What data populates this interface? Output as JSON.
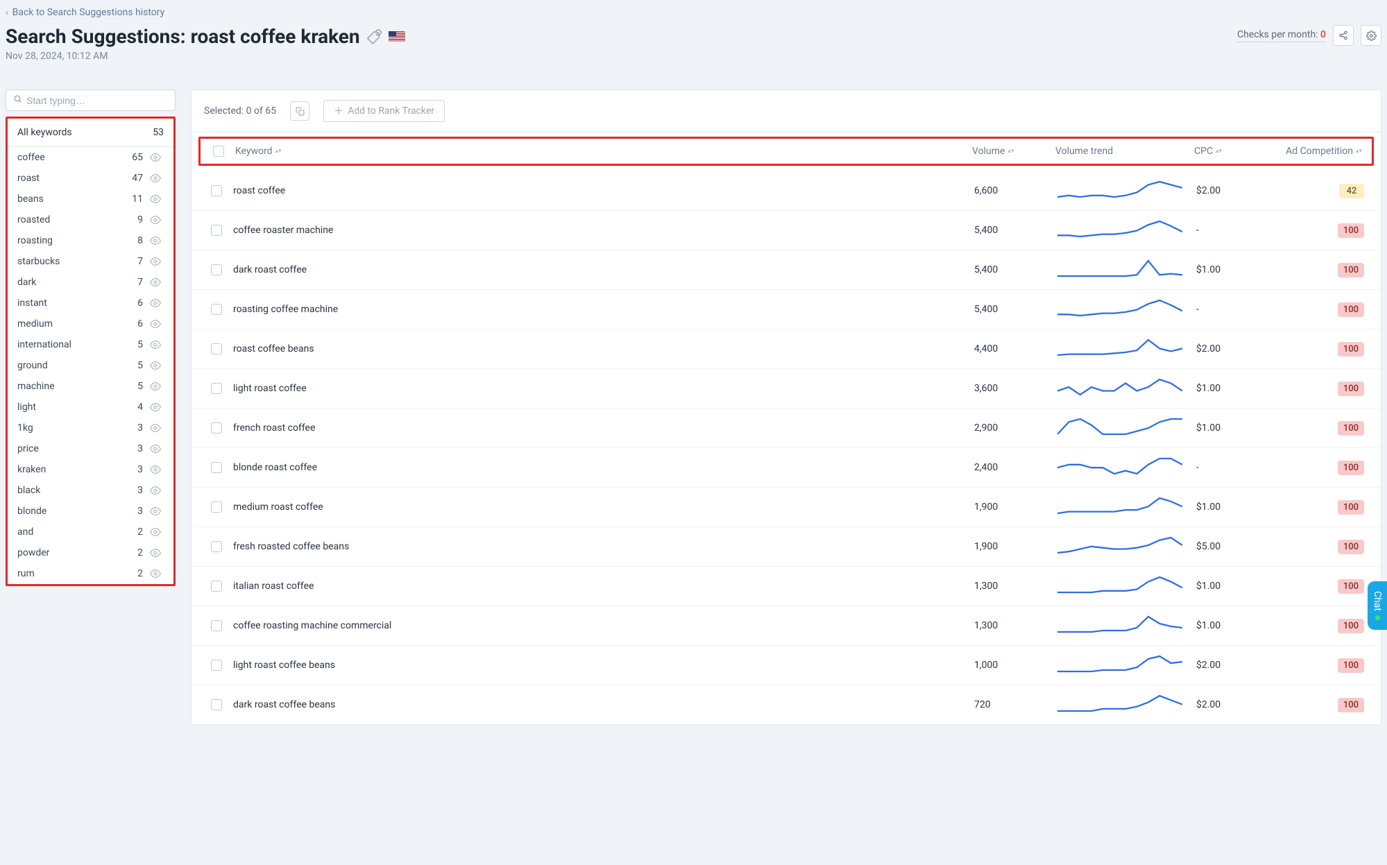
{
  "back_link": "Back to Search Suggestions history",
  "page_title_prefix": "Search Suggestions: ",
  "page_title_query": "roast coffee kraken",
  "timestamp": "Nov 28, 2024, 10:12 AM",
  "checks_label": "Checks per month: ",
  "checks_value": "0",
  "search_placeholder": "Start typing…",
  "sidebar": {
    "all_label": "All keywords",
    "all_count": "53",
    "items": [
      {
        "name": "coffee",
        "count": "65"
      },
      {
        "name": "roast",
        "count": "47"
      },
      {
        "name": "beans",
        "count": "11"
      },
      {
        "name": "roasted",
        "count": "9"
      },
      {
        "name": "roasting",
        "count": "8"
      },
      {
        "name": "starbucks",
        "count": "7"
      },
      {
        "name": "dark",
        "count": "7"
      },
      {
        "name": "instant",
        "count": "6"
      },
      {
        "name": "medium",
        "count": "6"
      },
      {
        "name": "international",
        "count": "5"
      },
      {
        "name": "ground",
        "count": "5"
      },
      {
        "name": "machine",
        "count": "5"
      },
      {
        "name": "light",
        "count": "4"
      },
      {
        "name": "1kg",
        "count": "3"
      },
      {
        "name": "price",
        "count": "3"
      },
      {
        "name": "kraken",
        "count": "3"
      },
      {
        "name": "black",
        "count": "3"
      },
      {
        "name": "blonde",
        "count": "3"
      },
      {
        "name": "and",
        "count": "2"
      },
      {
        "name": "powder",
        "count": "2"
      },
      {
        "name": "rum",
        "count": "2"
      }
    ]
  },
  "toolbar": {
    "selected_label": "Selected: 0 of 65",
    "add_label": "Add to Rank Tracker"
  },
  "columns": {
    "keyword": "Keyword",
    "volume": "Volume",
    "trend": "Volume trend",
    "cpc": "CPC",
    "comp": "Ad Competition"
  },
  "rows": [
    {
      "keyword": "roast coffee",
      "volume": "6,600",
      "cpc": "$2.00",
      "comp": "42",
      "comp_level": "yellow",
      "trend": [
        12,
        13,
        12,
        13,
        13,
        12,
        13,
        15,
        20,
        22,
        20,
        18
      ]
    },
    {
      "keyword": "coffee roaster machine",
      "volume": "5,400",
      "cpc": "-",
      "comp": "100",
      "comp_level": "red",
      "trend": [
        12,
        12,
        11,
        12,
        13,
        13,
        14,
        16,
        21,
        24,
        20,
        15
      ]
    },
    {
      "keyword": "dark roast coffee",
      "volume": "5,400",
      "cpc": "$1.00",
      "comp": "100",
      "comp_level": "red",
      "trend": [
        12,
        12,
        12,
        12,
        12,
        12,
        12,
        13,
        25,
        13,
        14,
        13
      ]
    },
    {
      "keyword": "roasting coffee machine",
      "volume": "5,400",
      "cpc": "-",
      "comp": "100",
      "comp_level": "red",
      "trend": [
        12,
        12,
        11,
        12,
        13,
        13,
        14,
        16,
        21,
        24,
        20,
        15
      ]
    },
    {
      "keyword": "roast coffee beans",
      "volume": "4,400",
      "cpc": "$2.00",
      "comp": "100",
      "comp_level": "red",
      "trend": [
        10,
        11,
        11,
        11,
        11,
        12,
        13,
        15,
        26,
        17,
        14,
        17
      ]
    },
    {
      "keyword": "light roast coffee",
      "volume": "3,600",
      "cpc": "$1.00",
      "comp": "100",
      "comp_level": "red",
      "trend": [
        13,
        14,
        12,
        14,
        13,
        13,
        15,
        13,
        14,
        16,
        15,
        13
      ]
    },
    {
      "keyword": "french roast coffee",
      "volume": "2,900",
      "cpc": "$1.00",
      "comp": "100",
      "comp_level": "red",
      "trend": [
        12,
        16,
        17,
        15,
        12,
        12,
        12,
        13,
        14,
        16,
        17,
        17
      ]
    },
    {
      "keyword": "blonde roast coffee",
      "volume": "2,400",
      "cpc": "-",
      "comp": "100",
      "comp_level": "red",
      "trend": [
        14,
        15,
        15,
        14,
        14,
        12,
        13,
        12,
        15,
        17,
        17,
        15
      ]
    },
    {
      "keyword": "medium roast coffee",
      "volume": "1,900",
      "cpc": "$1.00",
      "comp": "100",
      "comp_level": "red",
      "trend": [
        11,
        12,
        12,
        12,
        12,
        12,
        13,
        13,
        15,
        20,
        18,
        15
      ]
    },
    {
      "keyword": "fresh roasted coffee beans",
      "volume": "1,900",
      "cpc": "$5.00",
      "comp": "100",
      "comp_level": "red",
      "trend": [
        10,
        11,
        13,
        15,
        14,
        13,
        13,
        14,
        16,
        20,
        22,
        16
      ]
    },
    {
      "keyword": "italian roast coffee",
      "volume": "1,300",
      "cpc": "$1.00",
      "comp": "100",
      "comp_level": "red",
      "trend": [
        11,
        11,
        11,
        11,
        12,
        12,
        12,
        13,
        18,
        21,
        18,
        14
      ]
    },
    {
      "keyword": "coffee roasting machine commercial",
      "volume": "1,300",
      "cpc": "$1.00",
      "comp": "100",
      "comp_level": "red",
      "trend": [
        11,
        11,
        11,
        11,
        12,
        12,
        12,
        14,
        22,
        17,
        15,
        14
      ]
    },
    {
      "keyword": "light roast coffee beans",
      "volume": "1,000",
      "cpc": "$2.00",
      "comp": "100",
      "comp_level": "red",
      "trend": [
        11,
        11,
        11,
        11,
        12,
        12,
        12,
        14,
        20,
        22,
        17,
        18
      ]
    },
    {
      "keyword": "dark roast coffee beans",
      "volume": "720",
      "cpc": "$2.00",
      "comp": "100",
      "comp_level": "red",
      "trend": [
        11,
        11,
        11,
        11,
        12,
        12,
        12,
        13,
        15,
        18,
        16,
        14
      ]
    }
  ],
  "chat_label": "Chat"
}
